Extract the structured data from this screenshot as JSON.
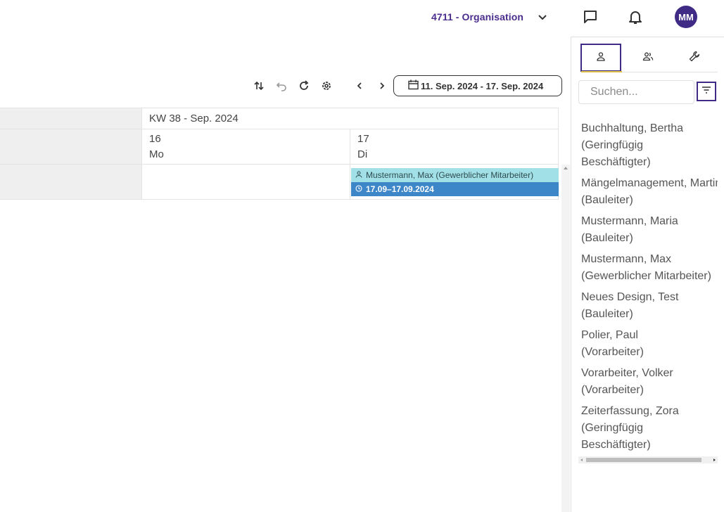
{
  "header": {
    "organisation": "4711 - Organisation",
    "avatar_initials": "MM",
    "icons": [
      "chevron-down-icon",
      "chat-icon",
      "bell-icon"
    ]
  },
  "toolbar": {
    "icons": [
      "sort-icon",
      "undo-icon",
      "refresh-icon",
      "settings-icon",
      "chevron-left-icon",
      "chevron-right-icon"
    ],
    "date_range": "11. Sep. 2024 - 17. Sep. 2024"
  },
  "calendar": {
    "week_label": "KW 38 - Sep. 2024",
    "days": [
      {
        "number": "16",
        "weekday": "Mo"
      },
      {
        "number": "17",
        "weekday": "Di"
      }
    ],
    "event": {
      "person": "Mustermann, Max (Gewerblicher Mitarbeiter)",
      "dates": "17.09–17.09.2024"
    }
  },
  "panel": {
    "tabs": [
      "person-icon",
      "group-icon",
      "wrench-icon"
    ],
    "search_placeholder": "Suchen...",
    "employees": [
      {
        "name": "Buchhaltung, Bertha",
        "role": "(Geringfügig",
        "role2": "Beschäftigter)"
      },
      {
        "name": "Mängelmanagement, Martin",
        "role": "(Bauleiter)"
      },
      {
        "name": "Mustermann, Maria",
        "role": "(Bauleiter)"
      },
      {
        "name": "Mustermann, Max",
        "role": "(Gewerblicher Mitarbeiter)"
      },
      {
        "name": "Neues Design, Test",
        "role": "(Bauleiter)"
      },
      {
        "name": "Polier, Paul",
        "role": "(Vorarbeiter)"
      },
      {
        "name": "Vorarbeiter, Volker",
        "role": "(Vorarbeiter)"
      },
      {
        "name": "Zeiterfassung, Zora",
        "role": "(Geringfügig",
        "role2": "Beschäftigter)"
      }
    ]
  },
  "colors": {
    "brand": "#3f2a86",
    "event_person": "#a1e0e6",
    "event_dates": "#3d86c8"
  }
}
